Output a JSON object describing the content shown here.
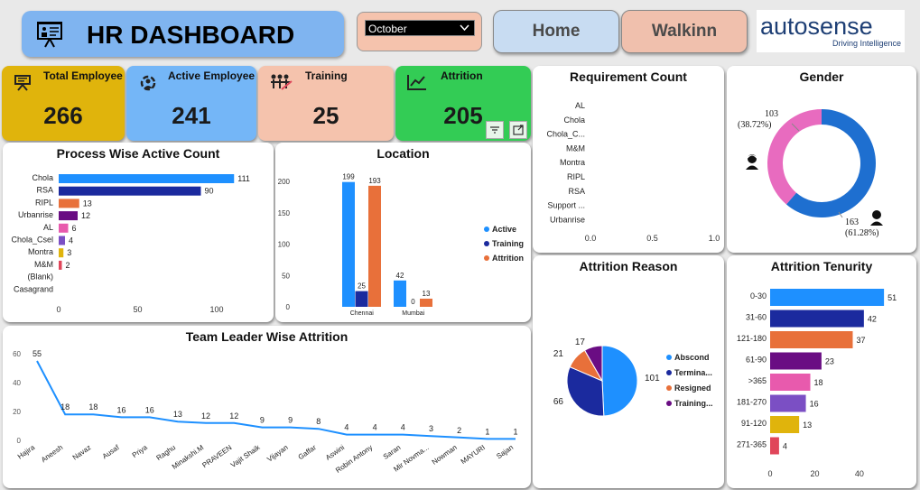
{
  "header": {
    "title": "HR DASHBOARD",
    "month_selected": "October",
    "home_label": "Home",
    "walkinn_label": "Walkinn",
    "logo_main": "autosense",
    "logo_sub": "Driving Intelligence"
  },
  "colors": {
    "blue": "#1e90ff",
    "navy": "#1b2a9e",
    "orange": "#e8703a",
    "purple": "#6a0d83",
    "pink": "#e85aad",
    "violet": "#7b4fc4",
    "gold": "#e0b40c",
    "red": "#e0465a",
    "pinkdonut": "#e86bbf",
    "bluedonut": "#1e6fd0"
  },
  "kpis": [
    {
      "label": "Total Employee",
      "value": "266",
      "color": "#e0b40c",
      "icon": "presenter-icon"
    },
    {
      "label": "Active Employee",
      "value": "241",
      "color": "#74b6f7",
      "icon": "team-icon"
    },
    {
      "label": "Training",
      "value": "25",
      "color": "#f5c3ad",
      "icon": "training-icon"
    },
    {
      "label": "Attrition",
      "value": "205",
      "color": "#33cc55",
      "icon": "trend-icon"
    }
  ],
  "panels": {
    "process": "Process Wise Active Count",
    "location": "Location",
    "requirement": "Requirement Count",
    "gender": "Gender",
    "team": "Team Leader Wise Attrition",
    "reason": "Attrition Reason",
    "tenure": "Attrition Tenurity"
  },
  "chart_data": [
    {
      "id": "process",
      "type": "bar",
      "orientation": "horizontal",
      "title": "Process Wise Active Count",
      "categories": [
        "Chola",
        "RSA",
        "RIPL",
        "Urbanrise",
        "AL",
        "Chola_Csel",
        "Montra",
        "M&M",
        "(Blank)",
        "Casagrand"
      ],
      "values": [
        111,
        90,
        13,
        12,
        6,
        4,
        3,
        2,
        null,
        null
      ],
      "colors": [
        "#1e90ff",
        "#1b2a9e",
        "#e8703a",
        "#6a0d83",
        "#e85aad",
        "#7b4fc4",
        "#e0b40c",
        "#e0465a",
        null,
        null
      ],
      "xticks": [
        "0",
        "50",
        "100"
      ],
      "xlim": [
        0,
        120
      ]
    },
    {
      "id": "location",
      "type": "bar",
      "title": "Location",
      "categories": [
        "Chennai",
        "Mumbai"
      ],
      "series": [
        {
          "name": "Active",
          "values": [
            199,
            42
          ],
          "color": "#1e90ff"
        },
        {
          "name": "Training",
          "values": [
            25,
            0
          ],
          "color": "#1b2a9e"
        },
        {
          "name": "Attrition",
          "values": [
            193,
            13
          ],
          "color": "#e8703a"
        }
      ],
      "yticks": [
        "0",
        "50",
        "100",
        "150",
        "200"
      ],
      "ylim": [
        0,
        200
      ]
    },
    {
      "id": "requirement",
      "type": "bar",
      "orientation": "horizontal",
      "title": "Requirement Count",
      "categories": [
        "AL",
        "Chola",
        "Chola_C...",
        "M&M",
        "Montra",
        "RIPL",
        "RSA",
        "Support ...",
        "Urbanrise"
      ],
      "values": [
        0,
        0,
        0,
        0,
        0,
        0,
        0,
        0,
        0
      ],
      "xticks": [
        "0.0",
        "0.5",
        "1.0"
      ],
      "xlim": [
        0,
        1
      ]
    },
    {
      "id": "gender",
      "type": "pie",
      "title": "Gender",
      "slices": [
        {
          "value": 163,
          "label": "163\n(61.28%)",
          "color": "#1e6fd0"
        },
        {
          "value": 103,
          "label": "103\n(38.72%)",
          "color": "#e86bbf"
        }
      ]
    },
    {
      "id": "team",
      "type": "line",
      "title": "Team Leader Wise Attrition",
      "categories": [
        "Hajira",
        "Aneesh",
        "Navaz",
        "Ausaf",
        "Priya",
        "Raghu",
        "Minakshi.M",
        "PRAVEEN",
        "Vajit Shaik",
        "Vijayan",
        "Gaffar",
        "Aswini",
        "Robin Antony",
        "Saran",
        "Mir Novma...",
        "Nowman",
        "MAYURI",
        "Sajan"
      ],
      "values": [
        55,
        18,
        18,
        16,
        16,
        13,
        12,
        12,
        9,
        9,
        8,
        4,
        4,
        4,
        3,
        2,
        1,
        1
      ],
      "yticks": [
        "0",
        "20",
        "40",
        "60"
      ],
      "ylim": [
        0,
        60
      ],
      "color": "#1e90ff"
    },
    {
      "id": "reason",
      "type": "pie",
      "title": "Attrition Reason",
      "slices": [
        {
          "name": "Abscond",
          "value": 101,
          "color": "#1e90ff"
        },
        {
          "name": "Termina...",
          "value": 66,
          "color": "#1b2a9e"
        },
        {
          "name": "Resigned",
          "value": 21,
          "color": "#e8703a"
        },
        {
          "name": "Training...",
          "value": 17,
          "color": "#6a0d83"
        }
      ]
    },
    {
      "id": "tenure",
      "type": "bar",
      "orientation": "horizontal",
      "title": "Attrition Tenurity",
      "categories": [
        "0-30",
        "31-60",
        "121-180",
        "61-90",
        ">365",
        "181-270",
        "91-120",
        "271-365"
      ],
      "values": [
        51,
        42,
        37,
        23,
        18,
        16,
        13,
        4
      ],
      "colors": [
        "#1e90ff",
        "#1b2a9e",
        "#e8703a",
        "#6a0d83",
        "#e85aad",
        "#7b4fc4",
        "#e0b40c",
        "#e0465a"
      ],
      "xticks": [
        "0",
        "20",
        "40"
      ],
      "xlim": [
        0,
        55
      ]
    }
  ]
}
